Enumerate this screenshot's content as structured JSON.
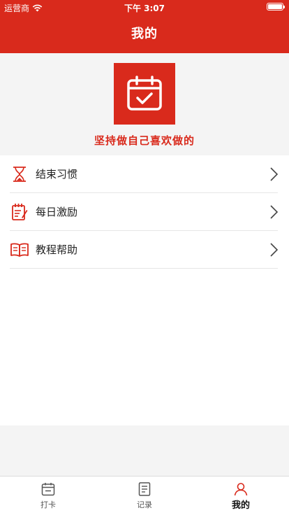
{
  "status_bar": {
    "carrier": "运营商",
    "time": "下午 3:07"
  },
  "header": {
    "title": "我的"
  },
  "profile": {
    "logo_icon": "calendar-check-icon",
    "slogan": "坚持做自己喜欢做的"
  },
  "menu": {
    "items": [
      {
        "label": "结束习惯",
        "icon": "hourglass-icon"
      },
      {
        "label": "每日激励",
        "icon": "notepad-icon"
      },
      {
        "label": "教程帮助",
        "icon": "book-icon"
      }
    ]
  },
  "tabbar": {
    "tabs": [
      {
        "label": "打卡",
        "icon": "calendar-icon",
        "active": false
      },
      {
        "label": "记录",
        "icon": "document-icon",
        "active": false
      },
      {
        "label": "我的",
        "icon": "person-icon",
        "active": true
      }
    ]
  },
  "colors": {
    "accent": "#d92a1c",
    "background": "#f4f4f4"
  }
}
